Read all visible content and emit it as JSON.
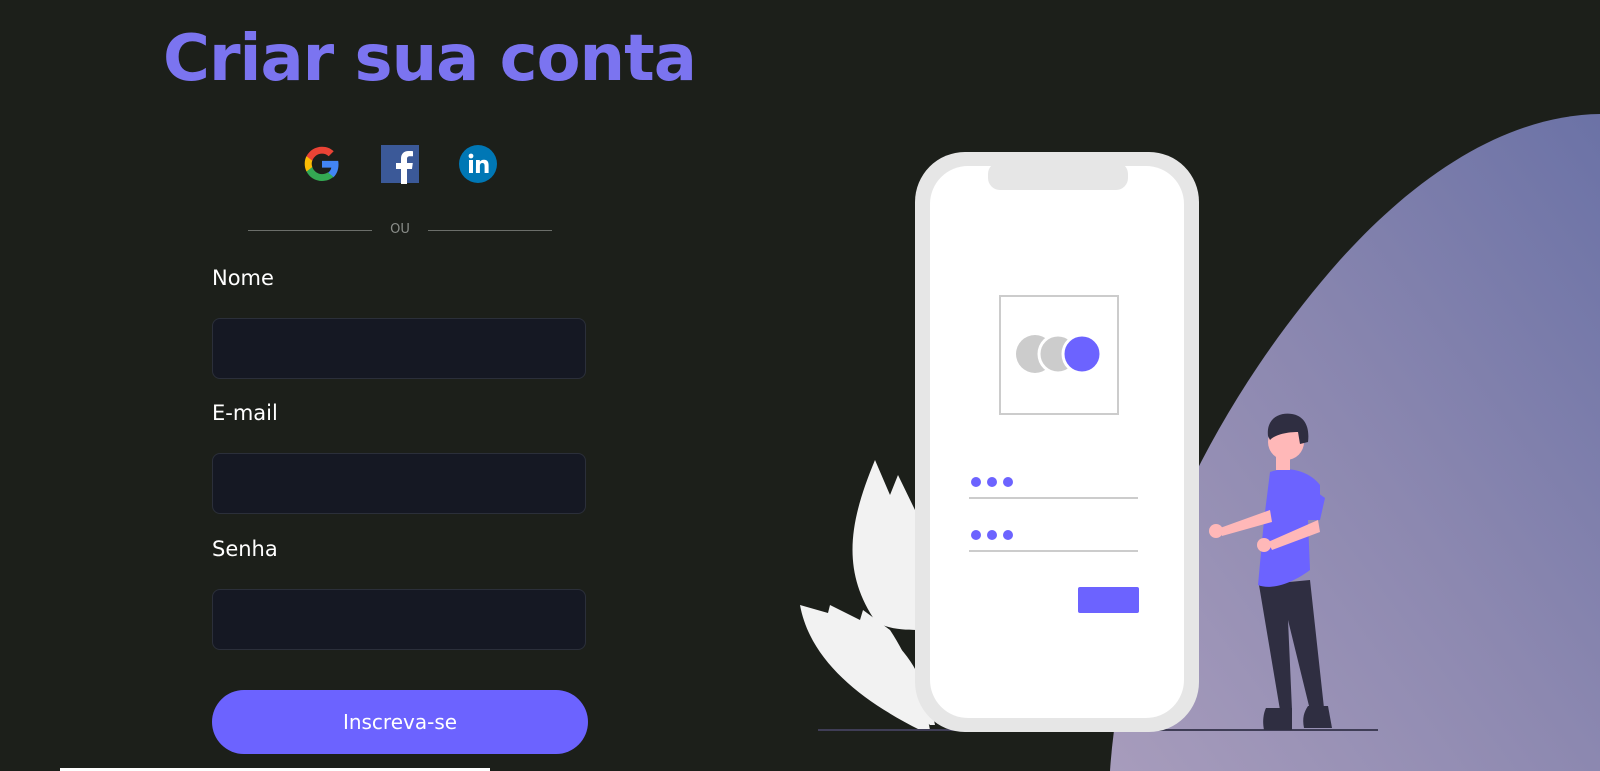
{
  "title": "Criar sua conta",
  "social": [
    {
      "name": "Google",
      "icon": "google-icon"
    },
    {
      "name": "Facebook",
      "icon": "facebook-icon"
    },
    {
      "name": "LinkedIn",
      "icon": "linkedin-icon"
    }
  ],
  "divider_text": "OU",
  "form": {
    "name_label": "Nome",
    "name_value": "",
    "email_label": "E-mail",
    "email_value": "",
    "password_label": "Senha",
    "password_value": "",
    "submit_label": "Inscreva-se"
  },
  "colors": {
    "background": "#1c1f1a",
    "accent": "#6c63ff",
    "title": "#7b74f0",
    "input_bg": "#151823"
  }
}
